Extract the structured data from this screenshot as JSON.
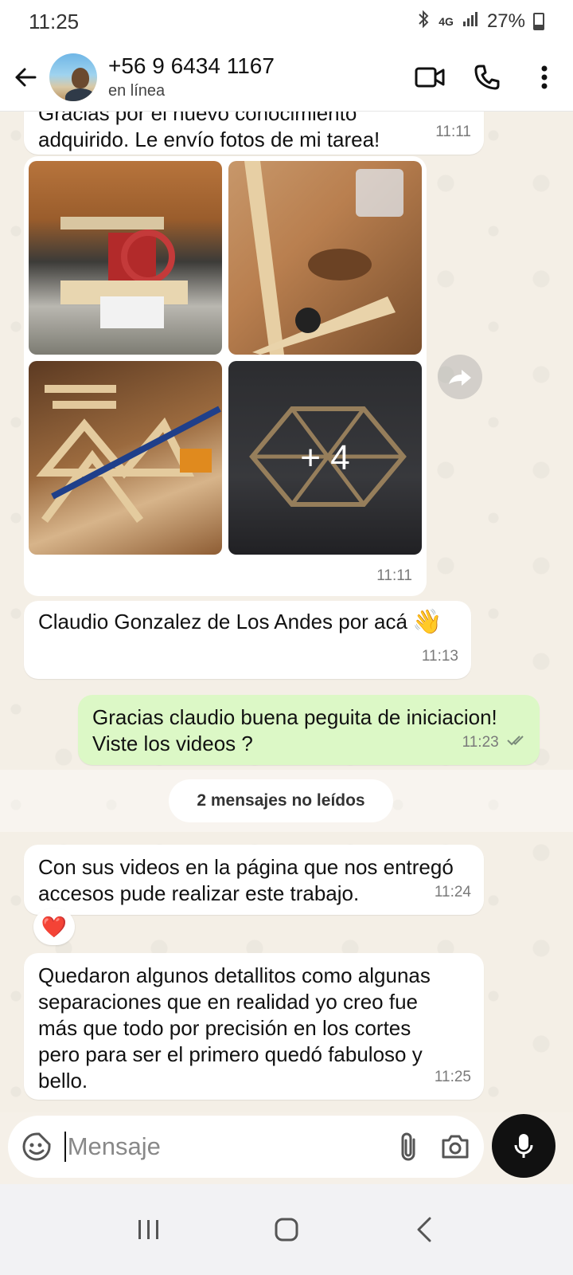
{
  "status_bar": {
    "time": "11:25",
    "network": "4G",
    "battery": "27%",
    "battery_level": 0.27
  },
  "header": {
    "contact_name": "+56 9 6434 1167",
    "contact_status": "en línea"
  },
  "messages": [
    {
      "direction": "in",
      "text_line1": "Gracias por el nuevo conocimiento",
      "text_line2": "adquirido. Le envío fotos de mi tarea!",
      "time": "11:11"
    },
    {
      "direction": "in",
      "type": "photo_grid",
      "more_count": "+ 4",
      "time": "11:11"
    },
    {
      "direction": "in",
      "text": "Claudio Gonzalez de Los Andes por acá",
      "emoji": "👋",
      "time": "11:13"
    },
    {
      "direction": "out",
      "text_line1": "Gracias claudio buena peguita de iniciacion!",
      "text_line2": "Viste los videos ?",
      "time": "11:23",
      "read": true
    },
    {
      "direction": "in",
      "text_line1": "Con sus videos en la página que nos entregó",
      "text_line2": "accesos pude realizar este trabajo.",
      "time": "11:24",
      "reaction": "❤️"
    },
    {
      "direction": "in",
      "lines": [
        "Quedaron algunos detallitos como algunas",
        "separaciones que en realidad yo creo fue",
        "más que todo por precisión en los cortes",
        "pero para ser el primero quedó fabuloso y",
        "bello."
      ],
      "time": "11:25"
    }
  ],
  "unread_divider": "2 mensajes no leídos",
  "input": {
    "placeholder": "Mensaje"
  },
  "colors": {
    "outgoing_bubble": "#dcf8c6",
    "incoming_bubble": "#ffffff",
    "chat_background": "#f4efe6",
    "read_ticks": "#53bdeb"
  },
  "icons": [
    "back-arrow-icon",
    "video-call-icon",
    "phone-icon",
    "more-vert-icon",
    "forward-icon",
    "sticker-icon",
    "attach-icon",
    "camera-icon",
    "mic-icon",
    "recents-icon",
    "home-icon",
    "nav-back-icon"
  ]
}
